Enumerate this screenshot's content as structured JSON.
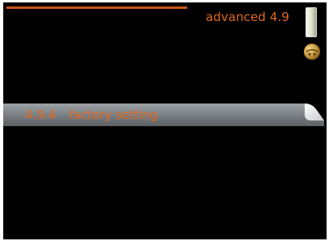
{
  "header": {
    "title": "advanced 4.9"
  },
  "menu": {
    "items": [
      {
        "number": "4.9.4",
        "label": "factory setting",
        "selected": true
      }
    ]
  },
  "icons": {
    "scroll": "scroll-indicator",
    "knob": "control-knob-icon"
  },
  "colors": {
    "background": "#000000",
    "accent": "#e0681f",
    "highlight_bar": "#8a8f93"
  }
}
